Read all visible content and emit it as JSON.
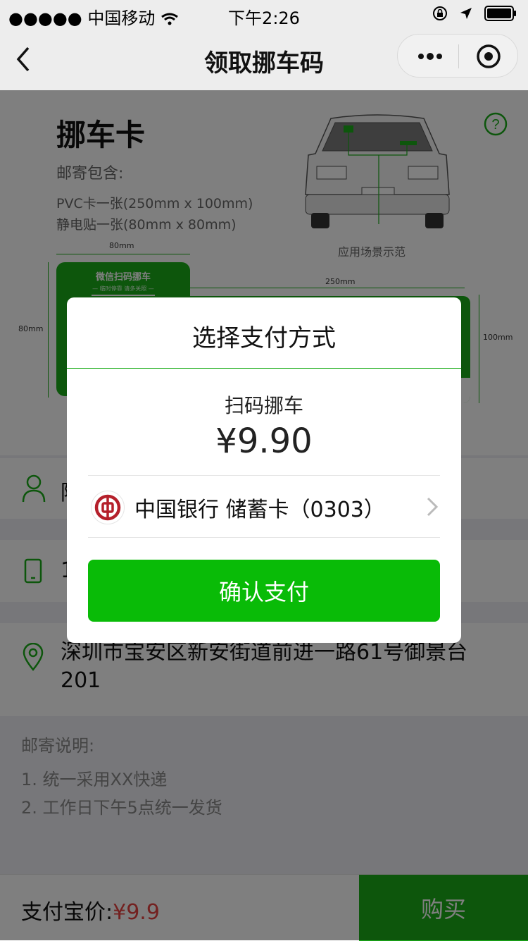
{
  "status_bar": {
    "signal": "●●●●●",
    "carrier": "中国移动",
    "time": "下午2:26"
  },
  "nav": {
    "title": "领取挪车码",
    "back_icon": "back-arrow-icon",
    "more_icon": "more-dots-icon",
    "close_icon": "target-icon"
  },
  "card": {
    "title": "挪车卡",
    "includes_label": "邮寄包含:",
    "includes": [
      "PVC卡一张(250mm x 100mm)",
      "静电贴一张(80mm x 80mm)"
    ],
    "scene_label": "应用场景示范",
    "sticker_width": "80mm",
    "sticker_height": "80mm",
    "card_width": "250mm",
    "card_height": "100mm",
    "sticker_text": "微信扫码挪车",
    "sticker_subtext": "— 临时停靠  请多关照 —"
  },
  "form": {
    "name_partial": "陈",
    "phone_partial": "1",
    "address": "深圳市宝安区新安街道前进一路61号御景台201"
  },
  "notes": {
    "title": "邮寄说明:",
    "items": [
      "1. 统一采用XX快递",
      "2. 工作日下午5点统一发货"
    ]
  },
  "bottom": {
    "label": "支付宝价:",
    "price": "¥9.9",
    "buy": "购买"
  },
  "dialog": {
    "title": "选择支付方式",
    "item": "扫码挪车",
    "amount": "¥9.90",
    "bank": "中国银行 储蓄卡（0303）",
    "confirm": "确认支付"
  },
  "colors": {
    "brand_green": "#1aad19",
    "confirm_green": "#09bb07",
    "price_red": "#e64340",
    "bank_red": "#b5202b"
  }
}
